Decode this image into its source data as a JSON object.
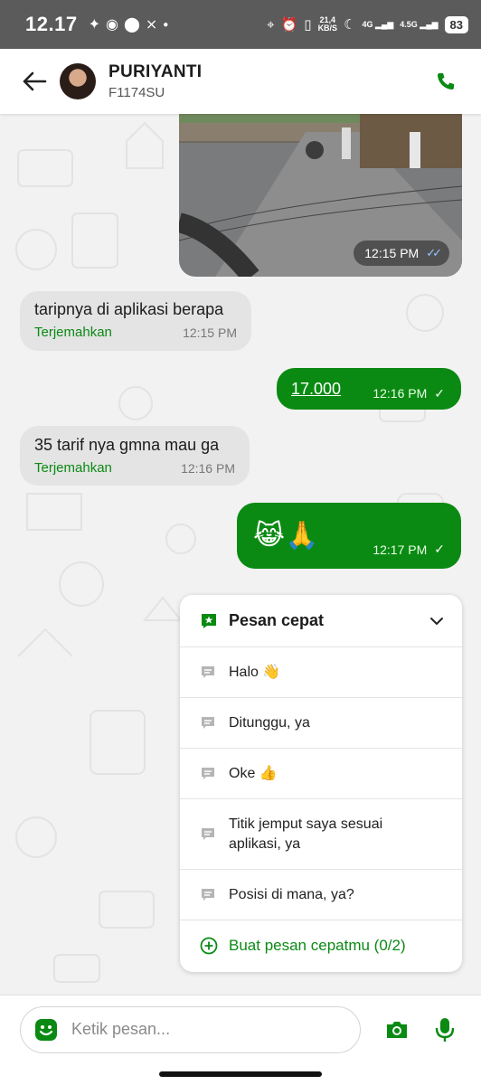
{
  "status_bar": {
    "time": "12.17",
    "net_speed_top": "21,4",
    "net_speed_bottom": "KB/S",
    "signal_1": "4G",
    "signal_2": "4.5G",
    "battery": "83"
  },
  "header": {
    "contact_name": "PURIYANTI",
    "plate_number": "F1174SU"
  },
  "messages": {
    "photo_time": "12:15 PM",
    "m1_text": "taripnya di aplikasi berapa",
    "m1_translate": "Terjemahkan",
    "m1_time": "12:15 PM",
    "m2_text": "17.000",
    "m2_time": "12:16 PM",
    "m3_text": "35 tarif nya gmna mau ga",
    "m3_translate": "Terjemahkan",
    "m3_time": "12:16 PM",
    "m4_text": "😹🙏",
    "m4_time": "12:17 PM"
  },
  "quick_reply": {
    "title": "Pesan cepat",
    "items": [
      {
        "label": "Halo 👋"
      },
      {
        "label": "Ditunggu, ya"
      },
      {
        "label": "Oke 👍"
      },
      {
        "label": "Titik jemput saya sesuai aplikasi, ya"
      },
      {
        "label": "Posisi di mana, ya?"
      }
    ],
    "create_label": "Buat pesan cepatmu (0/2)"
  },
  "input": {
    "placeholder": "Ketik pesan..."
  },
  "colors": {
    "accent": "#0a8a12",
    "incoming_bubble": "#e4e4e4",
    "status_bar": "#5b5b5b"
  }
}
